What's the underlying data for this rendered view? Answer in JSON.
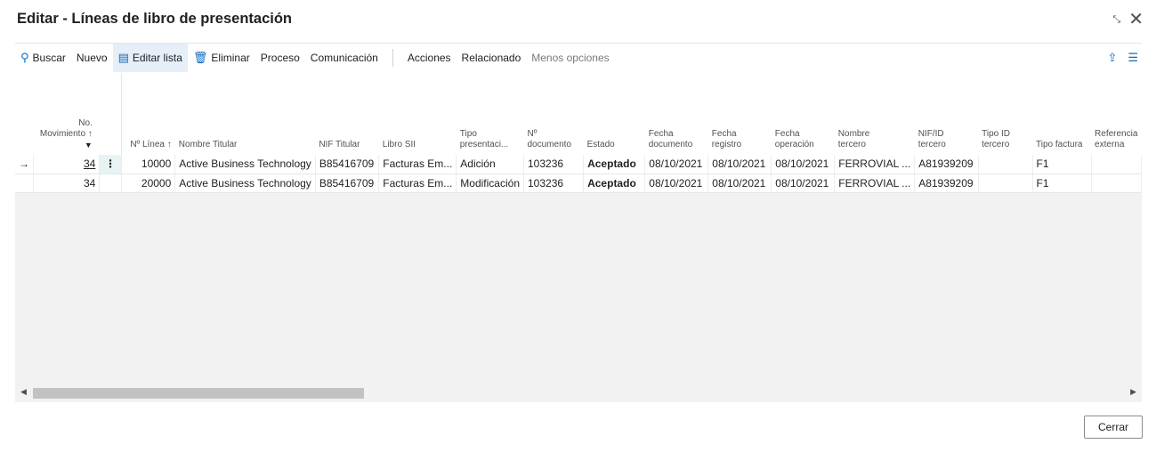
{
  "window": {
    "title": "Editar - Líneas de libro de presentación",
    "icons": [
      "collapse-icon",
      "close-icon"
    ]
  },
  "actions": {
    "buscar": "Buscar",
    "nuevo": "Nuevo",
    "editar_lista": "Editar lista",
    "eliminar": "Eliminar",
    "proceso": "Proceso",
    "comunicacion": "Comunicación",
    "acciones": "Acciones",
    "relacionado": "Relacionado",
    "menos_opciones": "Menos opciones"
  },
  "columns": {
    "no_movimiento_1": "No.",
    "no_movimiento_2": "Movimiento ↑",
    "no_linea": "Nº Línea ↑",
    "nombre_titular": "Nombre Titular",
    "nif_titular": "NIF Titular",
    "libro_sii": "Libro SII",
    "tipo_presentacion_1": "Tipo",
    "tipo_presentacion_2": "presentaci...",
    "no_documento_1": "Nº",
    "no_documento_2": "documento",
    "estado": "Estado",
    "fecha_documento_1": "Fecha",
    "fecha_documento_2": "documento",
    "fecha_registro_1": "Fecha",
    "fecha_registro_2": "registro",
    "fecha_operacion_1": "Fecha",
    "fecha_operacion_2": "operación",
    "nombre_tercero_1": "Nombre",
    "nombre_tercero_2": "tercero",
    "nif_tercero_1": "NIF/ID",
    "nif_tercero_2": "tercero",
    "tipo_id_tercero_1": "Tipo ID",
    "tipo_id_tercero_2": "tercero",
    "tipo_factura": "Tipo factura",
    "referencia_externa_1": "Referencia",
    "referencia_externa_2": "externa"
  },
  "rows": [
    {
      "marker": "→",
      "menu": "⋮",
      "no_movimiento": "34",
      "no_linea": "10000",
      "nombre_titular": "Active Business Technology",
      "nif_titular": "B85416709",
      "libro_sii": "Facturas Em...",
      "tipo_presentacion": "Adición",
      "no_documento": "103236",
      "estado": "Aceptado",
      "fecha_documento": "08/10/2021",
      "fecha_registro": "08/10/2021",
      "fecha_operacion": "08/10/2021",
      "nombre_tercero": "FERROVIAL ...",
      "nif_tercero": "A81939209",
      "tipo_id_tercero": "",
      "tipo_factura": "F1",
      "referencia_externa": ""
    },
    {
      "marker": "",
      "menu": "",
      "no_movimiento": "34",
      "no_linea": "20000",
      "nombre_titular": "Active Business Technology",
      "nif_titular": "B85416709",
      "libro_sii": "Facturas Em...",
      "tipo_presentacion": "Modificación",
      "no_documento": "103236",
      "estado": "Aceptado",
      "fecha_documento": "08/10/2021",
      "fecha_registro": "08/10/2021",
      "fecha_operacion": "08/10/2021",
      "nombre_tercero": "FERROVIAL ...",
      "nif_tercero": "A81939209",
      "tipo_id_tercero": "",
      "tipo_factura": "F1",
      "referencia_externa": ""
    }
  ],
  "footer": {
    "cerrar": "Cerrar"
  },
  "colors": {
    "accent": "#0f6cbd",
    "status_ok": "#0d7d0d",
    "grid_bg": "#f2f2f2"
  }
}
